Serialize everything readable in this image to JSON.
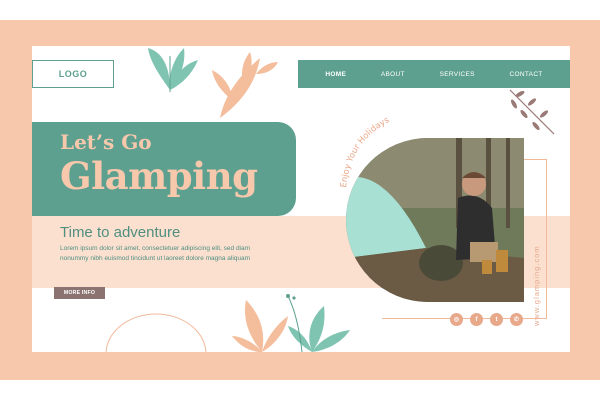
{
  "header": {
    "logo": "LOGO",
    "nav": [
      "HOME",
      "ABOUT",
      "SERVICES",
      "CONTACT"
    ]
  },
  "hero": {
    "title_line1": "Let’s Go",
    "title_line2": "Glamping",
    "subtitle": "Time to adventure",
    "description": "Lorem ipsum dolor sit amet, consectetuer adipiscing elit, sed diam nonummy nibh euismod tincidunt ut laoreet dolore magna aliquam",
    "button": "MORE INFO"
  },
  "photo": {
    "tagline": "Enjoy Your Holidays",
    "website": "www.glamping.com"
  },
  "social": [
    "instagram-icon",
    "facebook-icon",
    "twitter-icon",
    "whatsapp-icon"
  ],
  "colors": {
    "background": "#f8c8ac",
    "primary": "#5ea08f",
    "light_peach": "#fbe0d0",
    "button": "#8a7370",
    "accent": "#e8a88a"
  }
}
